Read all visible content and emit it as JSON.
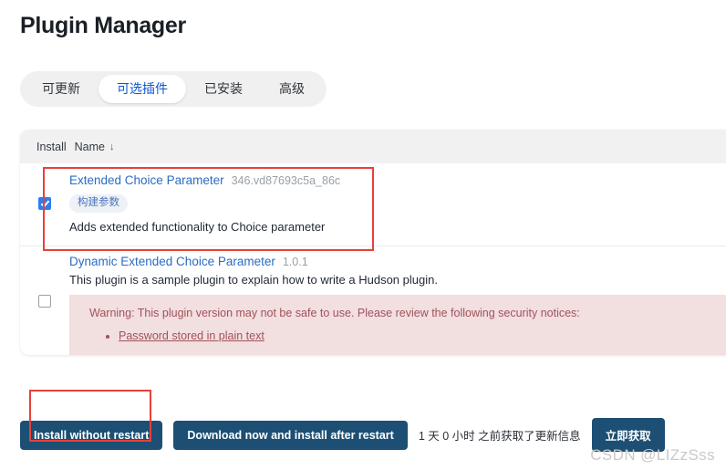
{
  "page": {
    "title": "Plugin Manager"
  },
  "tabs": [
    {
      "label": "可更新",
      "active": false
    },
    {
      "label": "可选插件",
      "active": true
    },
    {
      "label": "已安装",
      "active": false
    },
    {
      "label": "高级",
      "active": false
    }
  ],
  "table": {
    "columns": {
      "install": "Install",
      "name": "Name",
      "sort_indicator": "↓"
    },
    "rows": [
      {
        "checked": true,
        "name": "Extended Choice Parameter",
        "version": "346.vd87693c5a_86c",
        "tag": "构建参数",
        "excerpt": "Adds extended functionality to Choice parameter",
        "warning": null
      },
      {
        "checked": false,
        "name": "Dynamic Extended Choice Parameter",
        "version": "1.0.1",
        "tag": null,
        "excerpt": "This plugin is a sample plugin to explain how to write a Hudson plugin.",
        "warning": {
          "text": "Warning: This plugin version may not be safe to use. Please review the following security notices:",
          "notices": [
            "Password stored in plain text"
          ]
        }
      }
    ]
  },
  "footer": {
    "install_without_restart": "Install without restart",
    "download_install_after_restart": "Download now and install after restart",
    "update_status": "1 天 0 小时 之前获取了更新信息",
    "check_now": "立即获取"
  },
  "watermark": "CSDN @LIZzSss",
  "colors": {
    "accent_link": "#2b6cc4",
    "tab_active_text": "#0b57d0",
    "button_primary": "#1c4f73",
    "checkbox_checked": "#2a7ef0",
    "warning_bg": "#f2dfe0",
    "warning_text": "#a1525a",
    "annotation": "#e8403a"
  }
}
